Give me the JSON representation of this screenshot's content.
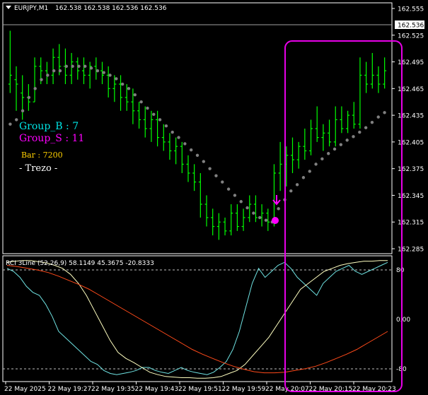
{
  "chart_data": [
    {
      "type": "bar",
      "subtype": "ohlc",
      "title": "EURJPY,M1",
      "ohlc_header": "162.538 162.538 162.536 162.536",
      "current_price": "162.536",
      "ylim": [
        162.285,
        162.555
      ],
      "yticks": [
        "162.555",
        "162.525",
        "162.495",
        "162.465",
        "162.435",
        "162.405",
        "162.375",
        "162.345",
        "162.315",
        "162.285"
      ],
      "bar_color": "#00ff00",
      "psar_color": "#808080",
      "bars": [
        {
          "o": 162.47,
          "h": 162.53,
          "l": 162.46,
          "c": 162.48
        },
        {
          "o": 162.475,
          "h": 162.49,
          "l": 162.44,
          "c": 162.47
        },
        {
          "o": 162.46,
          "h": 162.48,
          "l": 162.43,
          "c": 162.455
        },
        {
          "o": 162.455,
          "h": 162.47,
          "l": 162.44,
          "c": 162.45
        },
        {
          "o": 162.45,
          "h": 162.5,
          "l": 162.45,
          "c": 162.49
        },
        {
          "o": 162.49,
          "h": 162.5,
          "l": 162.47,
          "c": 162.485
        },
        {
          "o": 162.485,
          "h": 162.495,
          "l": 162.47,
          "c": 162.48
        },
        {
          "o": 162.48,
          "h": 162.51,
          "l": 162.47,
          "c": 162.5
        },
        {
          "o": 162.5,
          "h": 162.515,
          "l": 162.48,
          "c": 162.49
        },
        {
          "o": 162.49,
          "h": 162.51,
          "l": 162.47,
          "c": 162.48
        },
        {
          "o": 162.48,
          "h": 162.505,
          "l": 162.47,
          "c": 162.495
        },
        {
          "o": 162.495,
          "h": 162.5,
          "l": 162.475,
          "c": 162.485
        },
        {
          "o": 162.485,
          "h": 162.5,
          "l": 162.47,
          "c": 162.48
        },
        {
          "o": 162.48,
          "h": 162.495,
          "l": 162.465,
          "c": 162.49
        },
        {
          "o": 162.49,
          "h": 162.5,
          "l": 162.475,
          "c": 162.485
        },
        {
          "o": 162.485,
          "h": 162.495,
          "l": 162.47,
          "c": 162.48
        },
        {
          "o": 162.48,
          "h": 162.49,
          "l": 162.455,
          "c": 162.465
        },
        {
          "o": 162.465,
          "h": 162.48,
          "l": 162.45,
          "c": 162.47
        },
        {
          "o": 162.47,
          "h": 162.48,
          "l": 162.44,
          "c": 162.455
        },
        {
          "o": 162.455,
          "h": 162.47,
          "l": 162.44,
          "c": 162.45
        },
        {
          "o": 162.45,
          "h": 162.465,
          "l": 162.425,
          "c": 162.44
        },
        {
          "o": 162.44,
          "h": 162.45,
          "l": 162.42,
          "c": 162.43
        },
        {
          "o": 162.43,
          "h": 162.445,
          "l": 162.41,
          "c": 162.42
        },
        {
          "o": 162.42,
          "h": 162.44,
          "l": 162.405,
          "c": 162.43
        },
        {
          "o": 162.43,
          "h": 162.44,
          "l": 162.4,
          "c": 162.41
        },
        {
          "o": 162.41,
          "h": 162.425,
          "l": 162.395,
          "c": 162.405
        },
        {
          "o": 162.405,
          "h": 162.415,
          "l": 162.385,
          "c": 162.395
        },
        {
          "o": 162.395,
          "h": 162.41,
          "l": 162.38,
          "c": 162.4
        },
        {
          "o": 162.4,
          "h": 162.405,
          "l": 162.37,
          "c": 162.38
        },
        {
          "o": 162.38,
          "h": 162.39,
          "l": 162.36,
          "c": 162.37
        },
        {
          "o": 162.37,
          "h": 162.38,
          "l": 162.35,
          "c": 162.36
        },
        {
          "o": 162.36,
          "h": 162.37,
          "l": 162.32,
          "c": 162.335
        },
        {
          "o": 162.335,
          "h": 162.345,
          "l": 162.31,
          "c": 162.32
        },
        {
          "o": 162.32,
          "h": 162.33,
          "l": 162.3,
          "c": 162.31
        },
        {
          "o": 162.31,
          "h": 162.325,
          "l": 162.295,
          "c": 162.315
        },
        {
          "o": 162.315,
          "h": 162.32,
          "l": 162.3,
          "c": 162.305
        },
        {
          "o": 162.305,
          "h": 162.335,
          "l": 162.3,
          "c": 162.325
        },
        {
          "o": 162.325,
          "h": 162.335,
          "l": 162.305,
          "c": 162.31
        },
        {
          "o": 162.31,
          "h": 162.33,
          "l": 162.305,
          "c": 162.32
        },
        {
          "o": 162.32,
          "h": 162.345,
          "l": 162.315,
          "c": 162.335
        },
        {
          "o": 162.335,
          "h": 162.345,
          "l": 162.315,
          "c": 162.32
        },
        {
          "o": 162.32,
          "h": 162.335,
          "l": 162.31,
          "c": 162.325
        },
        {
          "o": 162.325,
          "h": 162.33,
          "l": 162.305,
          "c": 162.315
        },
        {
          "o": 162.315,
          "h": 162.38,
          "l": 162.31,
          "c": 162.37
        },
        {
          "o": 162.37,
          "h": 162.405,
          "l": 162.35,
          "c": 162.38
        },
        {
          "o": 162.38,
          "h": 162.4,
          "l": 162.355,
          "c": 162.39
        },
        {
          "o": 162.39,
          "h": 162.41,
          "l": 162.37,
          "c": 162.385
        },
        {
          "o": 162.385,
          "h": 162.405,
          "l": 162.375,
          "c": 162.4
        },
        {
          "o": 162.4,
          "h": 162.42,
          "l": 162.385,
          "c": 162.395
        },
        {
          "o": 162.395,
          "h": 162.43,
          "l": 162.39,
          "c": 162.42
        },
        {
          "o": 162.42,
          "h": 162.445,
          "l": 162.405,
          "c": 162.41
        },
        {
          "o": 162.41,
          "h": 162.425,
          "l": 162.395,
          "c": 162.415
        },
        {
          "o": 162.415,
          "h": 162.43,
          "l": 162.4,
          "c": 162.405
        },
        {
          "o": 162.405,
          "h": 162.445,
          "l": 162.4,
          "c": 162.43
        },
        {
          "o": 162.43,
          "h": 162.445,
          "l": 162.415,
          "c": 162.42
        },
        {
          "o": 162.42,
          "h": 162.44,
          "l": 162.415,
          "c": 162.435
        },
        {
          "o": 162.435,
          "h": 162.45,
          "l": 162.42,
          "c": 162.425
        },
        {
          "o": 162.425,
          "h": 162.5,
          "l": 162.42,
          "c": 162.48
        },
        {
          "o": 162.48,
          "h": 162.495,
          "l": 162.46,
          "c": 162.47
        },
        {
          "o": 162.47,
          "h": 162.505,
          "l": 162.465,
          "c": 162.48
        },
        {
          "o": 162.48,
          "h": 162.49,
          "l": 162.46,
          "c": 162.47
        },
        {
          "o": 162.47,
          "h": 162.5,
          "l": 162.465,
          "c": 162.485
        }
      ],
      "psar": [
        162.425,
        162.43,
        162.44,
        162.455,
        162.465,
        162.475,
        162.48,
        162.485,
        162.485,
        162.49,
        162.49,
        162.49,
        162.49,
        162.488,
        162.485,
        162.483,
        162.48,
        162.476,
        162.47,
        162.465,
        162.458,
        162.45,
        162.443,
        162.436,
        162.43,
        162.423,
        162.416,
        162.41,
        162.403,
        162.396,
        162.39,
        162.383,
        162.375,
        162.367,
        162.36,
        162.352,
        162.345,
        162.338,
        162.331,
        162.325,
        162.32,
        162.317,
        162.315,
        162.33,
        162.34,
        162.35,
        162.357,
        162.365,
        162.372,
        162.38,
        162.386,
        162.392,
        162.397,
        162.402,
        162.407,
        162.411,
        162.416,
        162.421,
        162.427,
        162.433,
        162.438
      ]
    },
    {
      "type": "line",
      "title": "RCI 3Line (52,26,9) 58.1149 45.3675 -20.8333",
      "ylim": [
        -100,
        100
      ],
      "level_labels": [
        "80",
        "0.00",
        "-80"
      ],
      "series": [
        {
          "color": "#6fe3e3",
          "values": [
            85,
            80,
            70,
            55,
            45,
            40,
            25,
            5,
            -20,
            -30,
            -40,
            -50,
            -60,
            -70,
            -75,
            -85,
            -90,
            -92,
            -90,
            -88,
            -85,
            -80,
            -80,
            -85,
            -88,
            -90,
            -85,
            -80,
            -85,
            -88,
            -90,
            -92,
            -88,
            -80,
            -70,
            -50,
            -20,
            20,
            60,
            85,
            70,
            80,
            90,
            95,
            85,
            70,
            60,
            50,
            40,
            60,
            70,
            80,
            85,
            90,
            80,
            75,
            80,
            85,
            90,
            95
          ]
        },
        {
          "color": "#ffffc0",
          "values": [
            95,
            97,
            98,
            98,
            96,
            94,
            90,
            85,
            75,
            60,
            40,
            15,
            -10,
            -35,
            -55,
            -65,
            -72,
            -80,
            -88,
            -92,
            -95,
            -96,
            -97,
            -97,
            -98,
            -98,
            -97,
            -95,
            -90,
            -85,
            -75,
            -60,
            -45,
            -30,
            -10,
            10,
            30,
            50,
            60,
            70,
            80,
            85,
            90,
            93,
            95,
            97,
            97,
            98,
            98
          ]
        },
        {
          "color": "#ff4a1a",
          "values": [
            90,
            88,
            85,
            82,
            78,
            72,
            65,
            58,
            50,
            40,
            30,
            20,
            10,
            0,
            -10,
            -20,
            -30,
            -40,
            -50,
            -58,
            -65,
            -72,
            -78,
            -83,
            -87,
            -89,
            -89,
            -88,
            -85,
            -82,
            -78,
            -72,
            -65,
            -58,
            -50,
            -40,
            -30,
            -20
          ]
        }
      ]
    }
  ],
  "annotations": {
    "group_b": "Group_B : 7",
    "group_s": "Group_S : 11",
    "bar": "Bar : 7200",
    "trezo": "- Trezo -",
    "group_b_color": "#00e5e5",
    "group_s_color": "#ff00ff",
    "bar_color": "#ffd000",
    "trezo_color": "#ffffff",
    "signal_arrow_icon": "down-arrow-icon",
    "signal_dot_icon": "dot-icon",
    "signal_color": "#ff00ff",
    "highlight_color": "#e800e8"
  },
  "time_axis": [
    "22 May 2025",
    "22 May 19:27",
    "22 May 19:35",
    "22 May 19:43",
    "22 May 19:51",
    "22 May 19:59",
    "22 May 20:07",
    "22 May 20:15",
    "22 May 20:23"
  ]
}
